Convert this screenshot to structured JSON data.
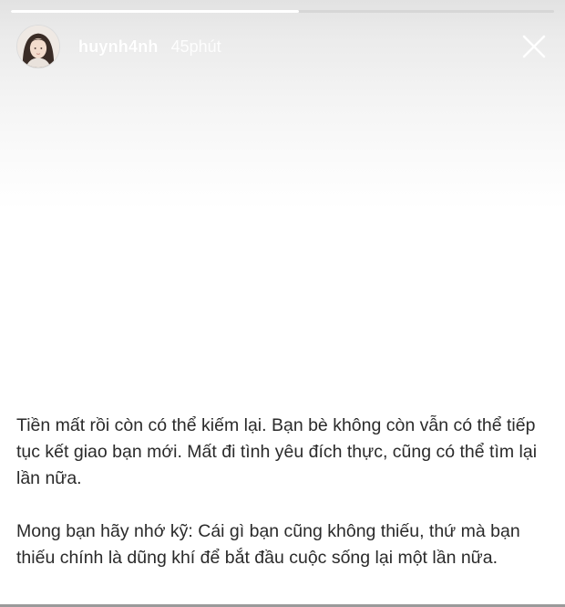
{
  "story": {
    "progress": 0.53,
    "username": "huynh4nh",
    "timestamp": "45phút",
    "close_icon": "close-icon",
    "avatar_icon": "avatar-photo",
    "paragraphs": [
      "Tiền mất rồi còn có thể kiếm lại. Bạn bè không còn vẫn có thể tiếp tục kết giao bạn mới. Mất đi tình yêu đích thực, cũng có thể tìm lại lần nữa.",
      "Mong bạn hãy nhớ kỹ: Cái gì bạn cũng không thiếu, thứ mà bạn thiếu chính là dũng khí để bắt đầu cuộc sống lại một lần nữa."
    ]
  },
  "colors": {
    "header_text": "#ffffff",
    "body_text": "#2a2a2a",
    "progress_track": "#d6d6d6",
    "progress_fill": "#ffffff"
  }
}
